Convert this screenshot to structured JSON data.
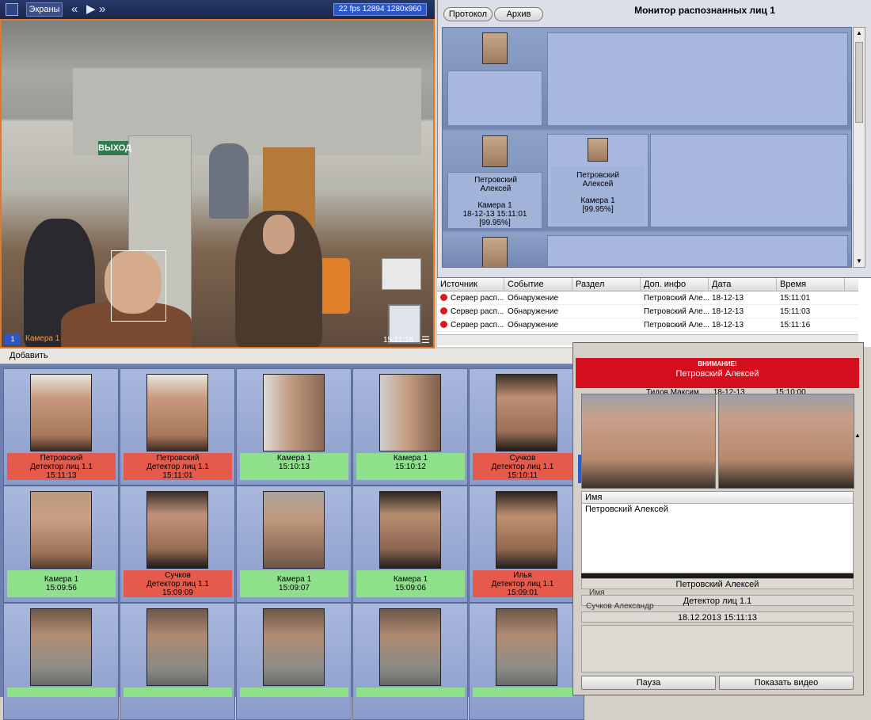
{
  "video": {
    "screens_label": "Экраны",
    "fps_text": "22 fps  12894 1280x960",
    "camera_index": "1",
    "camera_label": "Камера 1",
    "timestamp": "15:11:16",
    "exit_sign": "ВЫХОД"
  },
  "monitor": {
    "protocol_label": "Протокол",
    "archive_label": "Архив",
    "title": "Монитор распознанных лиц 1",
    "cards": [
      {
        "name": "Петровский Алексей",
        "camera": "Камера 1",
        "datetime": "18-12-13 15:11:01",
        "score": "[99.95%]"
      },
      {
        "name": "Петровский Алексей",
        "camera": "Камера 1",
        "datetime": "",
        "score": "[99.95%]"
      }
    ]
  },
  "events": {
    "columns": [
      "Источник",
      "Событие",
      "Раздел",
      "Доп. инфо",
      "Дата",
      "Время"
    ],
    "rows": [
      {
        "source": "Сервер расп...",
        "event": "Обнаружение",
        "section": "",
        "info": "Петровский Але...",
        "date": "18-12-13",
        "time": "15:11:01"
      },
      {
        "source": "Сервер расп...",
        "event": "Обнаружение",
        "section": "",
        "info": "Петровский Але...",
        "date": "18-12-13",
        "time": "15:11:03"
      },
      {
        "source": "Сервер расп...",
        "event": "Обнаружение",
        "section": "",
        "info": "Петровский Але...",
        "date": "18-12-13",
        "time": "15:11:16"
      }
    ]
  },
  "faces": {
    "add_label": "Добавить",
    "cells": [
      {
        "l1": "Петровский",
        "l2": "Детектор лиц 1.1",
        "l3": "15:11:13",
        "status": "red"
      },
      {
        "l1": "Петровский",
        "l2": "Детектор лиц 1.1",
        "l3": "15:11:01",
        "status": "red"
      },
      {
        "l1": "",
        "l2": "Камера 1",
        "l3": "15:10:13",
        "status": "green"
      },
      {
        "l1": "",
        "l2": "Камера 1",
        "l3": "15:10:12",
        "status": "green"
      },
      {
        "l1": "Сучков",
        "l2": "Детектор лиц 1.1",
        "l3": "15:10:11",
        "status": "red"
      },
      {
        "l1": "",
        "l2": "Камера 1",
        "l3": "15:09:56",
        "status": "green"
      },
      {
        "l1": "Сучков",
        "l2": "Детектор лиц 1.1",
        "l3": "15:09:09",
        "status": "red"
      },
      {
        "l1": "",
        "l2": "Камера 1",
        "l3": "15:09:07",
        "status": "green"
      },
      {
        "l1": "",
        "l2": "Камера 1",
        "l3": "15:09:06",
        "status": "green"
      },
      {
        "l1": "Илья",
        "l2": "Детектор лиц 1.1",
        "l3": "15:09:01",
        "status": "red"
      },
      {
        "l1": "",
        "l2": "",
        "l3": "",
        "status": "green"
      },
      {
        "l1": "",
        "l2": "",
        "l3": "",
        "status": "green"
      },
      {
        "l1": "",
        "l2": "",
        "l3": "",
        "status": "green"
      },
      {
        "l1": "",
        "l2": "",
        "l3": "",
        "status": "green"
      },
      {
        "l1": "",
        "l2": "",
        "l3": "",
        "status": "green"
      }
    ]
  },
  "alert": {
    "warning": "ВНИМАНИЕ!",
    "person": "Петровский Алексей",
    "bg_row": {
      "name": "Тидов Максим",
      "date": "18-12-13",
      "time": "15:10:00"
    },
    "name_header": "Имя",
    "name_value": "Петровский Алексей",
    "under_name": "Петровский Алексей",
    "under_header": "Имя",
    "detector": "Детектор лиц 1.1",
    "bg_name2": "Сучков Александр",
    "datetime": "18.12.2013 15:11:13",
    "pause_label": "Пауза",
    "show_video_label": "Показать видео"
  }
}
